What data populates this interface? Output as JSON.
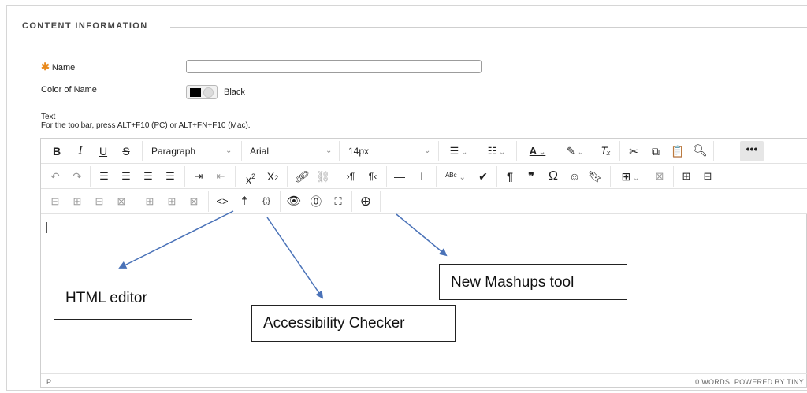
{
  "section": {
    "title": "CONTENT INFORMATION"
  },
  "form": {
    "required_marker": "✱",
    "name_label": "Name",
    "name_value": "",
    "color_label": "Color of Name",
    "color_value": "Black",
    "text_label": "Text",
    "toolbar_hint": "For the toolbar, press ALT+F10 (PC) or ALT+FN+F10 (Mac)."
  },
  "toolbar": {
    "bold": "B",
    "italic": "I",
    "underline": "U",
    "strike": "S",
    "block_format": "Paragraph",
    "font_family": "Arial",
    "font_size": "14px",
    "more": "•••",
    "superscript_base": "x",
    "superscript_mark": "2",
    "subscript_base": "X",
    "subscript_mark": "2",
    "omega": "Ω",
    "quote": "❞",
    "pilcrow": "¶"
  },
  "status": {
    "path": "P",
    "words": "0 WORDS",
    "powered": "POWERED BY TINY"
  },
  "callouts": {
    "html_editor": "HTML editor",
    "accessibility": "Accessibility Checker",
    "mashups": "New Mashups tool"
  },
  "colors": {
    "required": "#e8891c",
    "arrow": "#4a72b8",
    "swatch": "#000000"
  }
}
